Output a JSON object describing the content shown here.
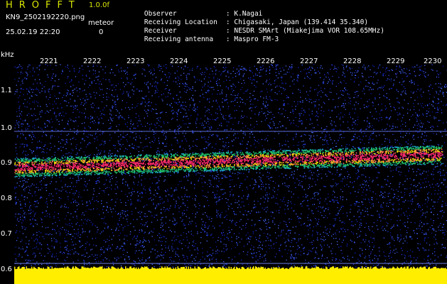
{
  "header": {
    "app_title": "HROFFT",
    "version": "1.0.0f",
    "filename": "KN9_2502192220.png",
    "meteor_label": "meteor",
    "datetime": "25.02.19 22:20",
    "meteor_count": "0",
    "observer_label": "Observer",
    "observer_value": "K.Nagai",
    "location_label": "Receiving Location",
    "location_value": "Chigasaki, Japan (139.414 35.340)",
    "receiver_label": "Receiver",
    "receiver_value": "NESDR SMArt (Miakejima VOR 108.65MHz)",
    "antenna_label": "Receiving antenna",
    "antenna_value": "Maspro FM-3"
  },
  "axis": {
    "y_unit": "kHz",
    "y_ticks": [
      "1.1",
      "1.0",
      "0.9",
      "0.8",
      "0.7",
      "0.6"
    ],
    "x_ticks": [
      "2221",
      "2222",
      "2223",
      "2224",
      "2225",
      "2226",
      "2227",
      "2228",
      "2229",
      "2230"
    ]
  },
  "colors": {
    "background": "#000000",
    "noise": "#1a2fd0",
    "signal_core": "#ff2a6a",
    "signal_halo": "#21c46a",
    "baseline": "#ffee00",
    "title": "#d9e600"
  },
  "signal": {
    "start_khz": 0.89,
    "end_khz": 0.93
  }
}
